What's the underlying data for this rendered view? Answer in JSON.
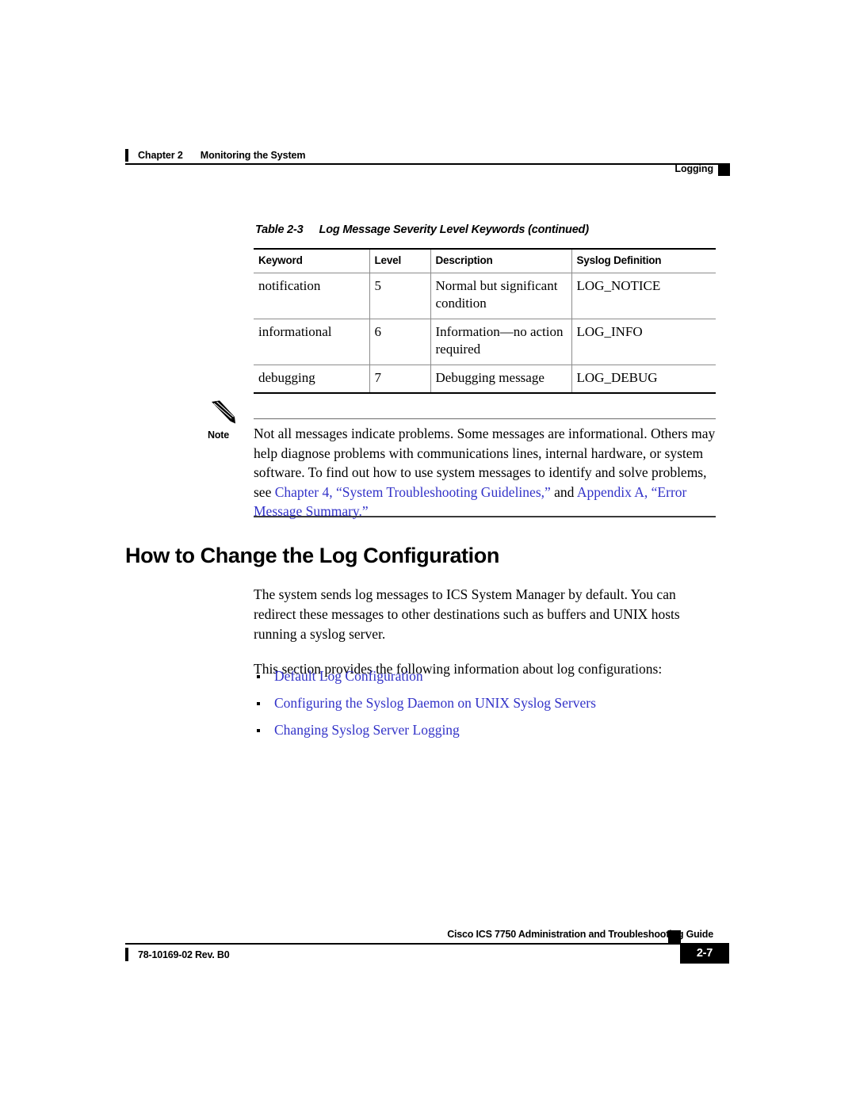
{
  "header": {
    "chapter_number": "Chapter 2",
    "chapter_title": "Monitoring the System",
    "topic": "Logging"
  },
  "table": {
    "caption_number": "Table 2-3",
    "caption_title": "Log Message Severity Level Keywords (continued)",
    "columns": [
      "Keyword",
      "Level",
      "Description",
      "Syslog Definition"
    ],
    "rows": [
      {
        "keyword": "notification",
        "level": "5",
        "description": "Normal but significant condition",
        "syslog": "LOG_NOTICE"
      },
      {
        "keyword": "informational",
        "level": "6",
        "description": "Information—no action required",
        "syslog": "LOG_INFO"
      },
      {
        "keyword": "debugging",
        "level": "7",
        "description": "Debugging message",
        "syslog": "LOG_DEBUG"
      }
    ]
  },
  "note": {
    "label": "Note",
    "icon": "pencil-icon",
    "text_before_links": "Not all messages indicate problems. Some messages are informational. Others may help diagnose problems with communications lines, internal hardware, or system software. To find out how to use system messages to identify and solve problems, see ",
    "link_1": "Chapter 4, “System Troubleshooting Guidelines,”",
    "text_between_links": " and ",
    "link_2": "Appendix A, “Error Message Summary.”"
  },
  "section": {
    "heading": "How to Change the Log Configuration",
    "paragraph_1": "The system sends log messages to ICS System Manager by default. You can redirect these messages to other destinations such as buffers and UNIX hosts running a syslog server.",
    "paragraph_2": "This section provides the following information about log configurations:",
    "links": [
      "Default Log Configuration",
      "Configuring the Syslog Daemon on UNIX Syslog Servers",
      "Changing Syslog Server Logging"
    ]
  },
  "footer": {
    "guide_title": "Cisco ICS 7750 Administration and Troubleshooting Guide",
    "doc_id": "78-10169-02 Rev. B0",
    "page_number": "2-7"
  },
  "colors": {
    "link": "#3232c8",
    "rule": "#000000",
    "table_inner_rule": "#8c8c8c"
  }
}
